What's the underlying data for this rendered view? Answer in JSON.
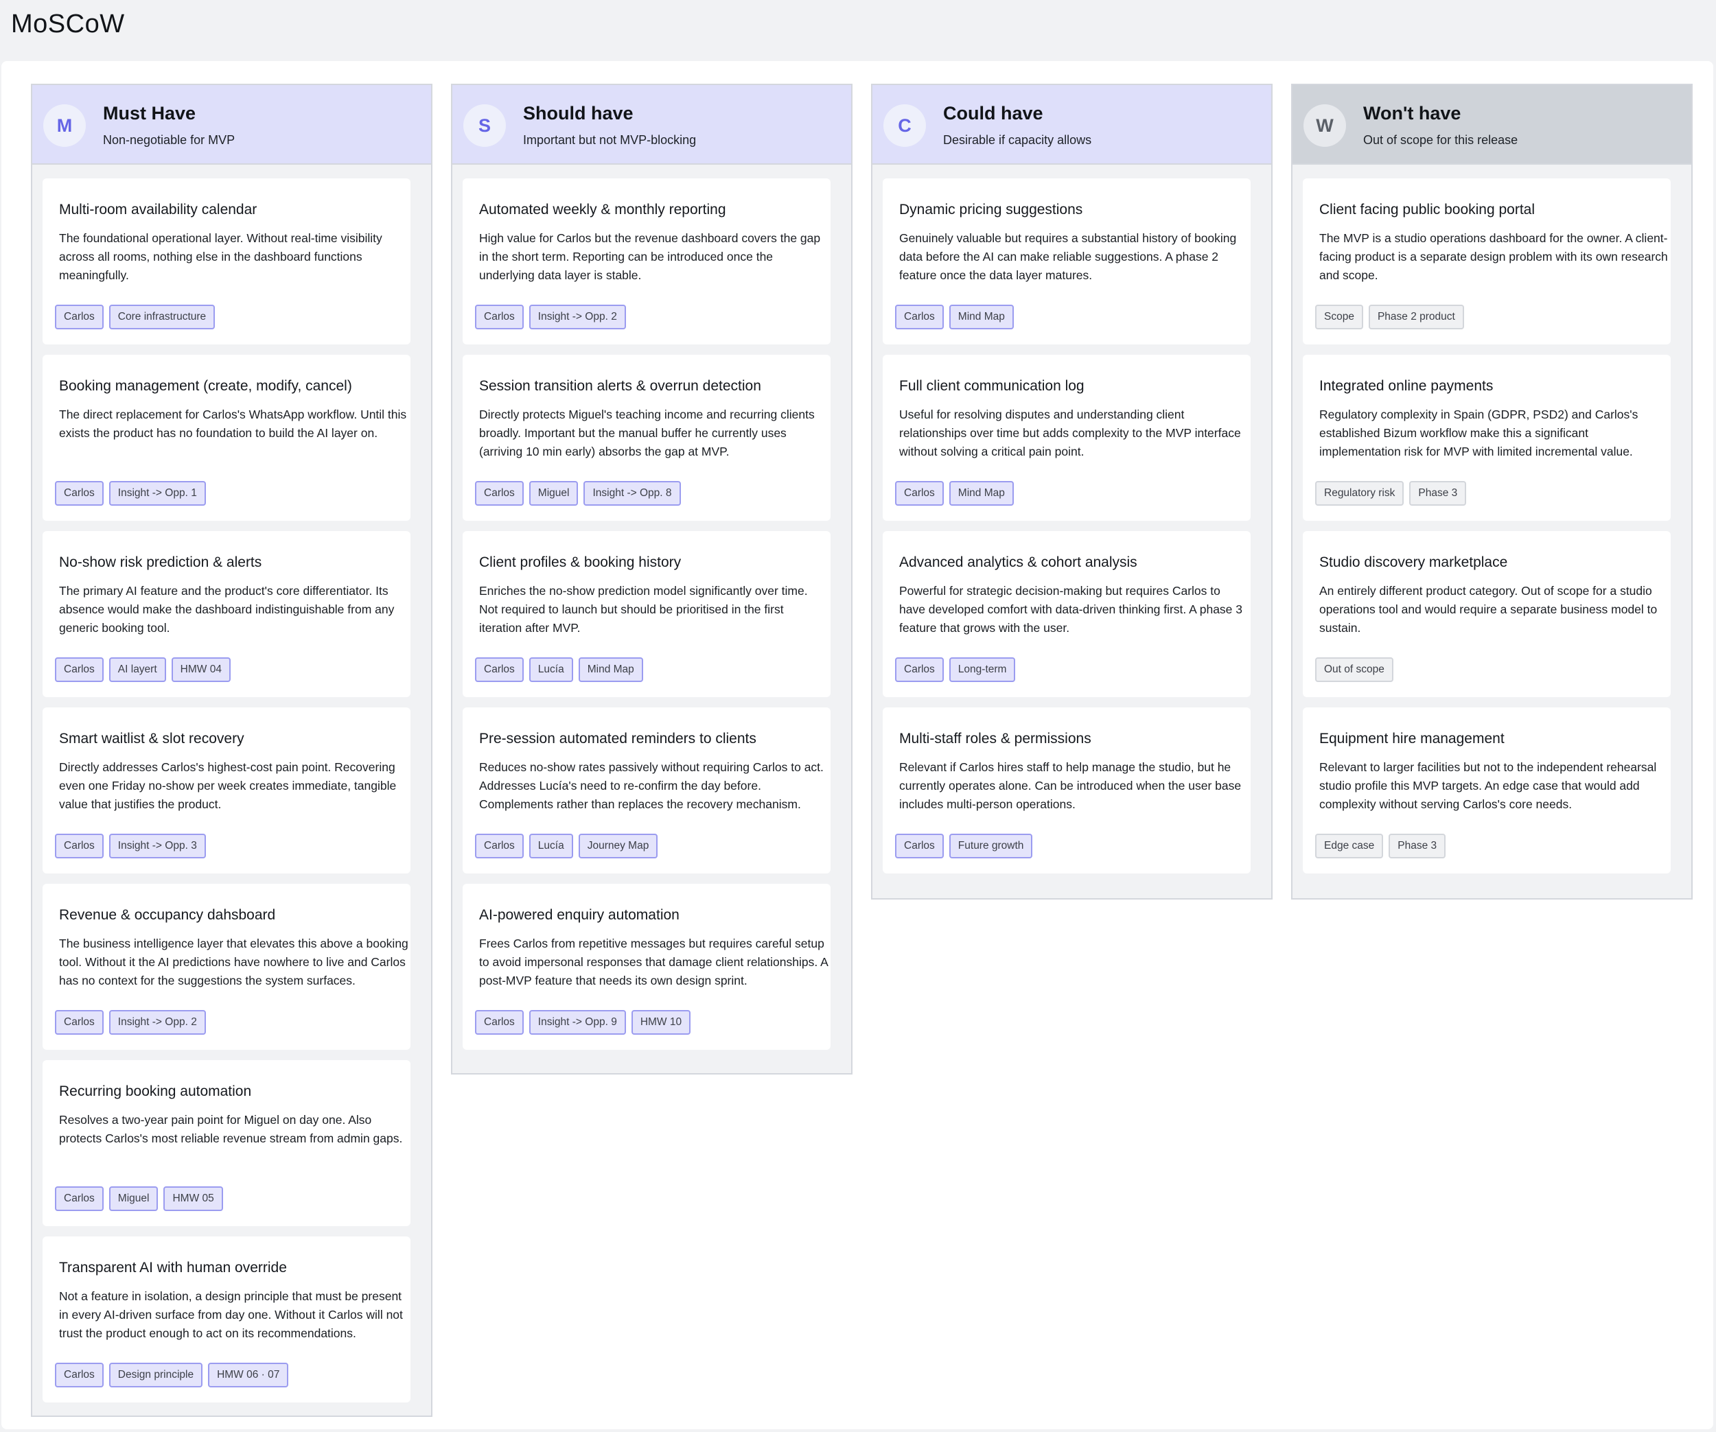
{
  "page": {
    "title": "MoSCoW"
  },
  "columns": [
    {
      "letter": "M",
      "title": "Must Have",
      "subtitle": "Non-negotiable for MVP",
      "cards": [
        {
          "title": "Multi-room availability calendar",
          "description": "The foundational operational layer. Without real-time visibility across all rooms, nothing else in the dashboard functions meaningfully.",
          "tags": [
            "Carlos",
            "Core infrastructure"
          ]
        },
        {
          "title": "Booking management (create, modify, cancel)",
          "description": "The direct replacement for Carlos's WhatsApp workflow. Until this exists the product has no foundation to build the AI layer on.",
          "tags": [
            "Carlos",
            "Insight -> Opp. 1"
          ]
        },
        {
          "title": "No-show risk prediction & alerts",
          "description": "The primary AI feature and the product's core differentiator. Its absence would make the dashboard indistinguishable from any generic booking tool.",
          "tags": [
            "Carlos",
            "AI layert",
            "HMW 04"
          ]
        },
        {
          "title": "Smart waitlist & slot recovery",
          "description": "Directly addresses Carlos's highest-cost pain point. Recovering even one Friday no-show per week creates immediate, tangible value that justifies the product.",
          "tags": [
            "Carlos",
            "Insight -> Opp. 3"
          ]
        },
        {
          "title": "Revenue & occupancy dahsboard",
          "description": "The business intelligence layer that elevates this above a booking tool. Without it the AI predictions have nowhere to live and Carlos has no context for the suggestions the system surfaces.",
          "tags": [
            "Carlos",
            "Insight -> Opp. 2"
          ]
        },
        {
          "title": "Recurring booking automation",
          "description": "Resolves a two-year pain point for Miguel on day one. Also protects Carlos's most reliable revenue stream from admin gaps.",
          "tags": [
            "Carlos",
            "Miguel",
            "HMW 05"
          ]
        },
        {
          "title": "Transparent AI with human override",
          "description": "Not a feature in isolation, a design principle that must be present in every AI-driven surface from day one. Without it Carlos will not trust the product enough to act on its recommendations.",
          "tags": [
            "Carlos",
            "Design principle",
            "HMW 06 · 07"
          ]
        }
      ]
    },
    {
      "letter": "S",
      "title": "Should have",
      "subtitle": "Important but not MVP-blocking",
      "cards": [
        {
          "title": "Automated weekly & monthly reporting",
          "description": "High value for Carlos but the revenue dashboard covers the gap in the short term. Reporting can be introduced once the underlying data layer is stable.",
          "tags": [
            "Carlos",
            "Insight -> Opp. 2"
          ]
        },
        {
          "title": "Session transition alerts & overrun detection",
          "description": "Directly protects Miguel's teaching income and recurring clients broadly. Important but the manual buffer he currently uses (arriving 10 min early) absorbs the gap at MVP.",
          "tags": [
            "Carlos",
            "Miguel",
            "Insight -> Opp. 8"
          ]
        },
        {
          "title": "Client profiles & booking history",
          "description": "Enriches the no-show prediction model significantly over time. Not required to launch but should be prioritised in the first iteration after MVP.",
          "tags": [
            "Carlos",
            "Lucía",
            "Mind Map"
          ]
        },
        {
          "title": "Pre-session automated reminders to clients",
          "description": "Reduces no-show rates passively without requiring Carlos to act. Addresses Lucía's need to re-confirm the day before. Complements rather than replaces the recovery mechanism.",
          "tags": [
            "Carlos",
            "Lucía",
            "Journey Map"
          ]
        },
        {
          "title": "AI-powered enquiry automation",
          "description": "Frees Carlos from repetitive messages but requires careful setup to avoid impersonal responses that damage client relationships. A post-MVP feature that needs its own design sprint.",
          "tags": [
            "Carlos",
            "Insight -> Opp. 9",
            "HMW 10"
          ]
        }
      ]
    },
    {
      "letter": "C",
      "title": "Could have",
      "subtitle": "Desirable if capacity allows",
      "cards": [
        {
          "title": "Dynamic pricing suggestions",
          "description": "Genuinely valuable but requires a substantial history of booking data before the AI can make reliable suggestions. A phase 2 feature once the data layer matures.",
          "tags": [
            "Carlos",
            "Mind Map"
          ]
        },
        {
          "title": "Full client communication log",
          "description": "Useful for resolving disputes and understanding client relationships over time but adds complexity to the MVP interface without solving a critical pain point.",
          "tags": [
            "Carlos",
            "Mind Map"
          ]
        },
        {
          "title": "Advanced analytics & cohort analysis",
          "description": "Powerful for strategic decision-making but requires Carlos to have developed comfort with data-driven thinking first. A phase 3 feature that grows with the user.",
          "tags": [
            "Carlos",
            "Long-term"
          ]
        },
        {
          "title": "Multi-staff roles & permissions",
          "description": "Relevant if Carlos hires staff to help manage the studio, but he currently operates alone. Can be introduced when the user base includes multi-person operations.",
          "tags": [
            "Carlos",
            "Future growth"
          ]
        }
      ]
    },
    {
      "letter": "W",
      "title": "Won't have",
      "subtitle": "Out of scope for this release",
      "cards": [
        {
          "title": "Client facing public booking portal",
          "description": "The MVP is a studio operations dashboard for the owner. A client-facing product is a separate design problem with its own research and scope.",
          "tags": [
            "Scope",
            "Phase 2 product"
          ]
        },
        {
          "title": "Integrated online payments",
          "description": "Regulatory complexity in Spain (GDPR, PSD2) and Carlos's established Bizum workflow make this a significant implementation risk for MVP with limited incremental value.",
          "tags": [
            "Regulatory risk",
            "Phase 3"
          ]
        },
        {
          "title": "Studio discovery marketplace",
          "description": "An entirely different product category. Out of scope for a studio operations tool and would require a separate business model to sustain.",
          "tags": [
            "Out of scope"
          ]
        },
        {
          "title": "Equipment hire management",
          "description": "Relevant to larger facilities but not to the independent rehearsal studio profile this MVP targets. An edge case that would add complexity without serving Carlos's core needs.",
          "tags": [
            "Edge case",
            "Phase 3"
          ]
        }
      ]
    }
  ]
}
